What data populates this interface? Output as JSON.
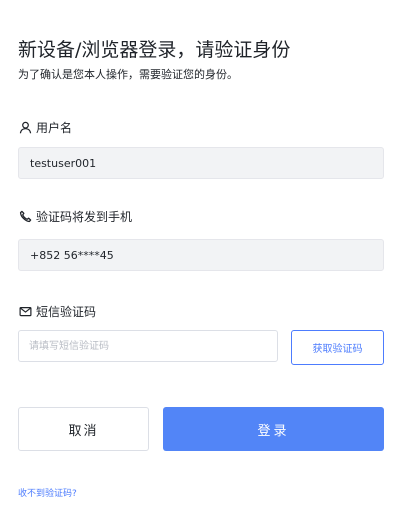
{
  "header": {
    "title": "新设备/浏览器登录，请验证身份",
    "subtitle": "为了确认是您本人操作，需要验证您的身份。"
  },
  "username_field": {
    "icon": "user-icon",
    "label": "用户名",
    "value": "testuser001"
  },
  "phone_field": {
    "icon": "phone-icon",
    "label": "验证码将发到手机",
    "value": "+852 56****45"
  },
  "sms_field": {
    "icon": "message-icon",
    "label": "短信验证码",
    "value": "",
    "placeholder": "请填写短信验证码",
    "get_code_label": "获取验证码"
  },
  "actions": {
    "cancel_label": "取消",
    "login_label": "登录"
  },
  "footer": {
    "no_code_link": "收不到验证码?"
  },
  "colors": {
    "primary": "#5285f7",
    "link": "#4d7cfe",
    "readonly_bg": "#f2f3f5"
  }
}
